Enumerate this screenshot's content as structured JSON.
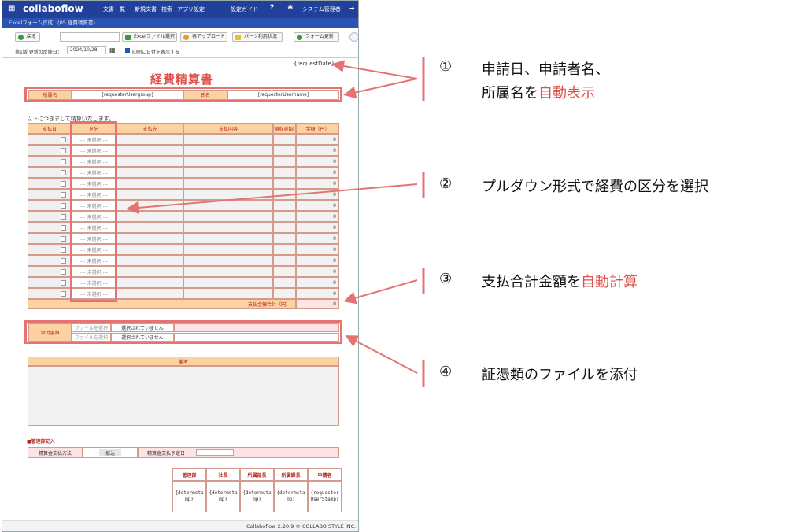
{
  "app": {
    "logo": "collaboflow",
    "menu": [
      "文書一覧",
      "新規文書",
      "検索",
      "アプリ設定",
      "設定ガイド",
      "システム管理者"
    ],
    "breadcrumb": "Excelフォーム作成 （05.経費精算書）"
  },
  "toolbar": {
    "back": "戻る",
    "excel_select": "Excelファイル選択",
    "reupload": "再アップロード",
    "parts_usage": "パーツ利用状況",
    "form_update": "フォーム更新"
  },
  "version": {
    "label": "第1版 更新の反映日：",
    "date": "2024/10/28",
    "print_date": "印刷に日付を表示する"
  },
  "form": {
    "request_date": "{requestDate}",
    "title": "経費精算書",
    "dept_label": "所属名",
    "dept_value": "{requesterUsergroup}",
    "name_label": "氏名",
    "name_value": "{requesterUsername}",
    "intro": "以下につきまして精算いたします。",
    "columns": [
      "支払日",
      "区分",
      "支払先",
      "支払内容",
      "領収書No",
      "金額（円）"
    ],
    "row_select": "--- 未選択 ---",
    "row_amount": "0",
    "total_label": "支払金額合計（円）",
    "total_value": "0",
    "attach_label": "添付書類",
    "file_btn": "ファイルを選択",
    "file_none": "選択されていません",
    "remarks_label": "備考",
    "admin_heading": "■管理部記入",
    "pay_method_label": "精算金支払方法",
    "pay_method_value": "振込",
    "pay_date_label": "精算金支払予定日",
    "stamps": [
      "管理部",
      "社長",
      "所属部長",
      "所属課長",
      "申請者"
    ],
    "stamp_values": [
      "{determstamp}",
      "{determstamp}",
      "{determstamp}",
      "{determstamp}",
      "{requesterUserStamp}"
    ]
  },
  "footer": "Collaboflow 2.20.9 © COLLABO STYLE INC.",
  "annotations": {
    "a1_num": "①",
    "a1_line1": "申請日、申請者名、",
    "a1_line2a": "所属名を",
    "a1_line2b": "自動表示",
    "a2_num": "②",
    "a2_text": "プルダウン形式で経費の区分を選択",
    "a3_num": "③",
    "a3_texta": "支払合計金額を",
    "a3_textb": "自動計算",
    "a4_num": "④",
    "a4_text": "証憑類のファイルを添付"
  },
  "colors": {
    "accent_red": "#e0504a",
    "header_blue": "#20409a",
    "header_orange": "#fbd3a3"
  }
}
